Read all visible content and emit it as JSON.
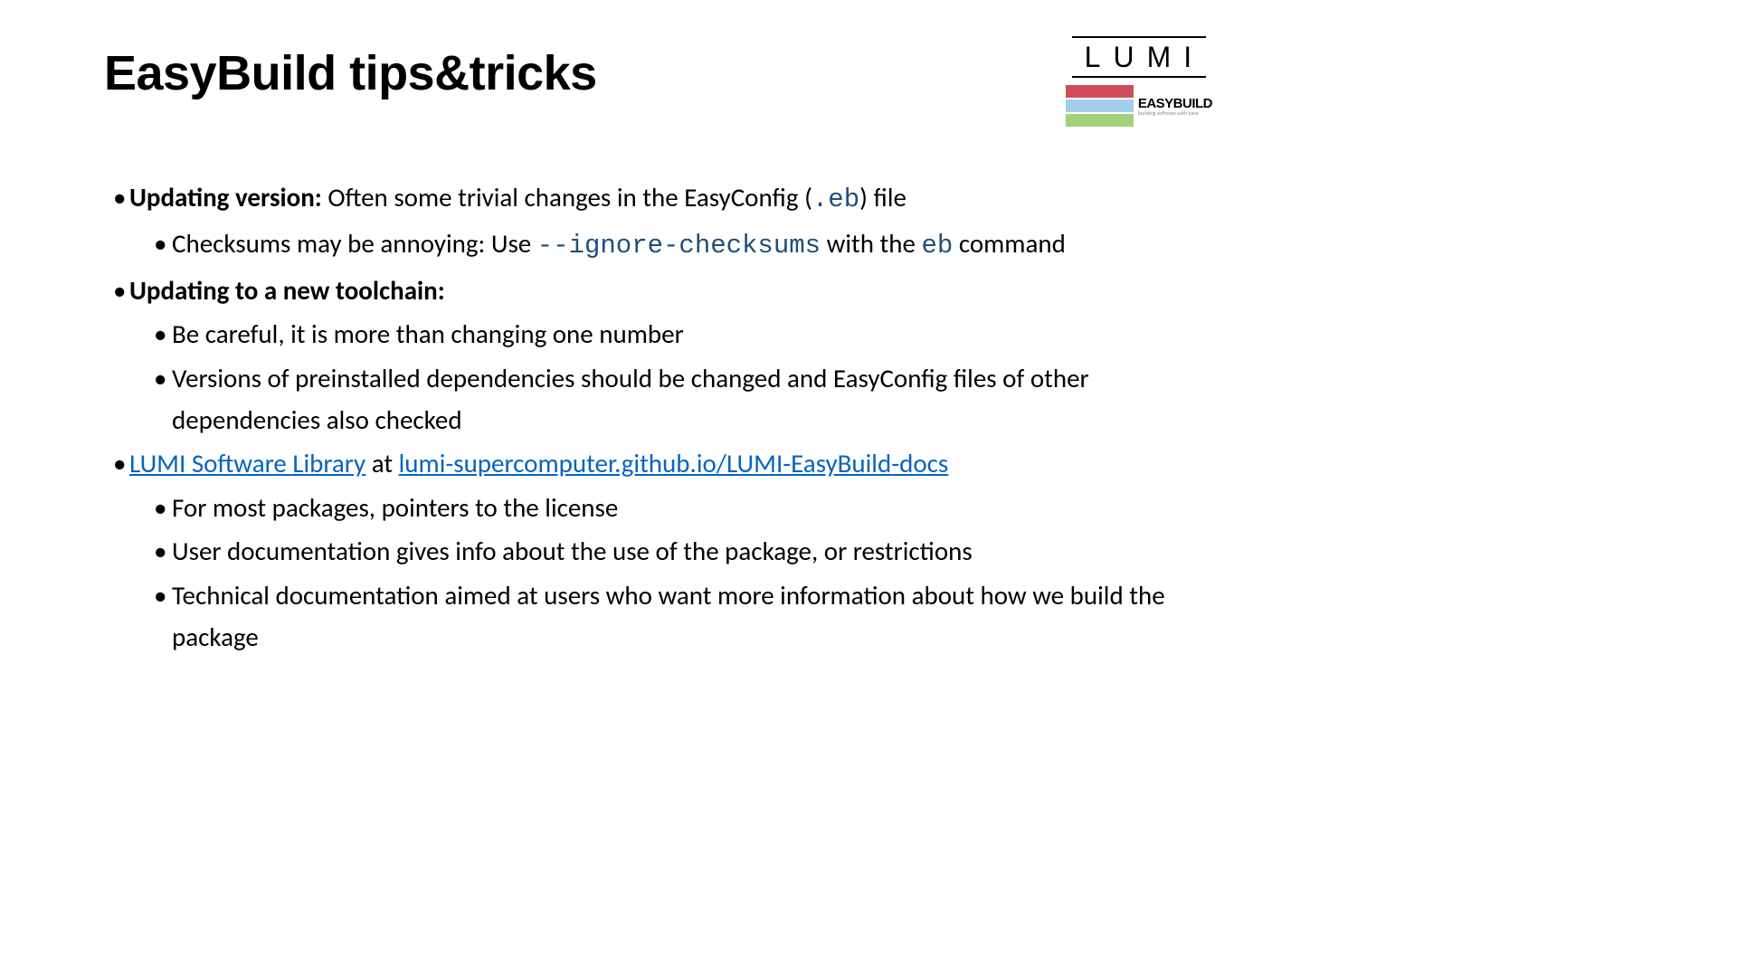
{
  "title": "EasyBuild tips&tricks",
  "logos": {
    "lumi": "LUMI",
    "easybuild_main": "EASYBUILD",
    "easybuild_sub": "building software with ease"
  },
  "bullets": {
    "b1": {
      "bold": "Updating version:",
      "rest1": " Often some trivial changes in the EasyConfig (",
      "code": ".eb",
      "rest2": ") file"
    },
    "b1s1": {
      "pre": "Checksums may be annoying: Use ",
      "code1": "--ignore-checksums",
      "mid": " with the ",
      "code2": "eb",
      "post": " command"
    },
    "b2": {
      "bold": "Updating to a new toolchain:"
    },
    "b2s1": "Be careful, it is more than changing one number",
    "b2s2": "Versions of preinstalled dependencies should be changed and EasyConfig files of other dependencies also checked",
    "b3": {
      "link1": "LUMI Software Library",
      "mid": " at ",
      "link2": "lumi-supercomputer.github.io/LUMI-EasyBuild-docs"
    },
    "b3s1": "For most packages, pointers to the license",
    "b3s2": "User documentation gives info about the use of the package, or restrictions",
    "b3s3": "Technical documentation aimed at users who want more information about how we build the package"
  }
}
